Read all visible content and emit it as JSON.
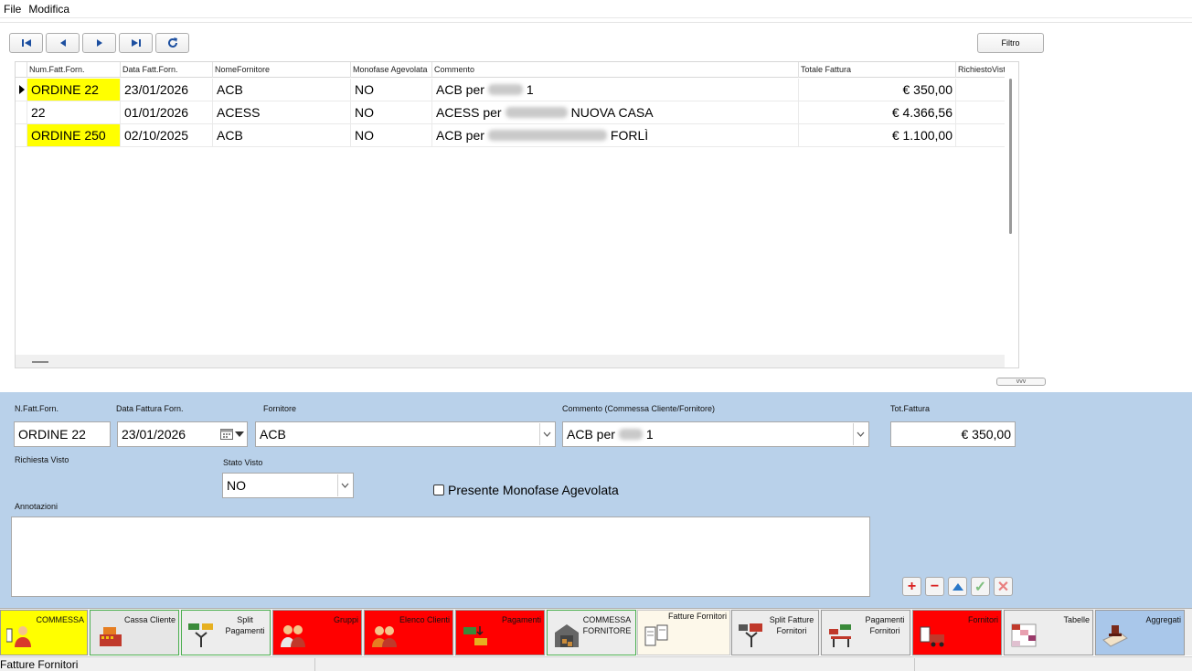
{
  "menu": [
    "File",
    "Modifica"
  ],
  "toolbar": {
    "filter_label": "Filtro",
    "splitter_label": "vvv"
  },
  "grid": {
    "columns": [
      "Num.Fatt.Forn.",
      "Data Fatt.Forn.",
      "NomeFornitore",
      "Monofase Agevolata",
      "Commento",
      "Totale Fattura",
      "RichiestoVisto"
    ],
    "rows": [
      {
        "num": "ORDINE 22",
        "data": "23/01/2026",
        "fornitore": "ACB",
        "monofase": "NO",
        "commento_pre": "ACB per",
        "commento_post": "1",
        "totale": "€ 350,00",
        "highlight": true,
        "current": true
      },
      {
        "num": "22",
        "data": "01/01/2026",
        "fornitore": "ACESS",
        "monofase": "NO",
        "commento_pre": "ACESS per",
        "commento_post": "NUOVA CASA",
        "totale": "€ 4.366,56",
        "highlight": false,
        "current": false
      },
      {
        "num": "ORDINE 250",
        "data": "02/10/2025",
        "fornitore": "ACB",
        "monofase": "NO",
        "commento_pre": "ACB per",
        "commento_post": "FORLÌ",
        "totale": "€ 1.100,00",
        "highlight": true,
        "current": false
      }
    ]
  },
  "form": {
    "nfatt_label": "N.Fatt.Forn.",
    "nfatt_value": "ORDINE 22",
    "data_label": "Data Fattura Forn.",
    "data_value": "23/01/2026",
    "fornitore_label": "Fornitore",
    "fornitore_value": "ACB",
    "commento_label": "Commento (Commessa Cliente/Fornitore)",
    "commento_pre": "ACB per",
    "commento_post": "1",
    "tot_label": "Tot.Fattura",
    "tot_value": "€ 350,00",
    "richiesta_label": "Richiesta Visto",
    "stato_label": "Stato Visto",
    "stato_value": "NO",
    "monofase_label": "Presente Monofase Agevolata",
    "monofase_checked": false,
    "annotazioni_label": "Annotazioni",
    "annotazioni_value": ""
  },
  "tabs": [
    {
      "label": "COMMESSA",
      "bg": "#ffff00",
      "icon": "commessa-icon"
    },
    {
      "label": "Cassa Cliente",
      "bg": "#e6e6e6",
      "icon": "cash-register-icon"
    },
    {
      "label": "Split Pagamenti",
      "bg": "#ededed",
      "icon": "split-icon"
    },
    {
      "label": "Gruppi",
      "bg": "#ff0000",
      "icon": "group-icon"
    },
    {
      "label": "Elenco Clienti",
      "bg": "#ff0000",
      "icon": "clients-icon"
    },
    {
      "label": "Pagamenti",
      "bg": "#ff0000",
      "icon": "payments-icon"
    },
    {
      "label": "COMMESSA FORNITORE",
      "bg": "#ededed",
      "icon": "warehouse-icon"
    },
    {
      "label": "Fatture Fornitori",
      "bg": "#fdf8ea",
      "icon": "invoices-icon"
    },
    {
      "label": "Split Fatture Fornitori",
      "bg": "#ededed",
      "icon": "split-invoice-icon"
    },
    {
      "label": "Pagamenti Fornitori",
      "bg": "#ededed",
      "icon": "supplier-payments-icon"
    },
    {
      "label": "Fornitori",
      "bg": "#ff0000",
      "icon": "truck-icon"
    },
    {
      "label": "Tabelle",
      "bg": "#ededed",
      "icon": "table-icon"
    },
    {
      "label": "Aggregati",
      "bg": "#a9c7ea",
      "icon": "aggregate-icon"
    }
  ],
  "status": {
    "text": "Fatture Fornitori"
  },
  "colors": {
    "highlight": "#ffff00",
    "form_bg": "#b9d1ea",
    "red_tab": "#ff0000",
    "add": "#e02020",
    "confirm": "#6fbf6f"
  }
}
